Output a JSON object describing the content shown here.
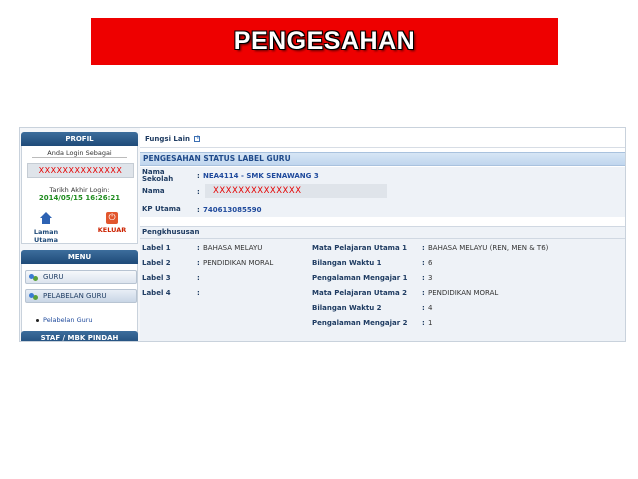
{
  "banner": {
    "title": "PENGESAHAN"
  },
  "sidebar": {
    "profile_header": "PROFIL",
    "login_as": "Anda Login Sebagai",
    "profile_name": "XXXXXXXXXXXXXX",
    "last_login_label": "Tarikh Akhir Login:",
    "last_login_value": "2014/05/15 16:26:21",
    "home_label": "Laman Utama",
    "logout_label": "KELUAR",
    "menu_header": "MENU",
    "menu_items": [
      {
        "label": "GURU"
      },
      {
        "label": "PELABELAN GURU"
      }
    ],
    "sub_item": "Pelabelan Guru",
    "staf_header": "STAF / MBK PINDAH"
  },
  "main": {
    "tab_label": "Fungsi Lain",
    "section_title": "PENGESAHAN STATUS LABEL GURU",
    "school_label_1": "Nama",
    "school_label_2": "Sekolah",
    "school_value": "NEA4114 - SMK SENAWANG 3",
    "name_label": "Nama",
    "name_value": "XXXXXXXXXXXXXX",
    "kp_label": "KP Utama",
    "kp_value": "740613085590",
    "colon": ":",
    "spec_title": "Pengkhususan",
    "labels": [
      {
        "label": "Label 1",
        "value": "BAHASA MELAYU"
      },
      {
        "label": "Label 2",
        "value": "PENDIDIKAN MORAL"
      },
      {
        "label": "Label 3",
        "value": ""
      },
      {
        "label": "Label 4",
        "value": ""
      }
    ],
    "subjects": [
      {
        "label": "Mata Pelajaran Utama 1",
        "value": "BAHASA MELAYU (REN, MEN & T6)"
      },
      {
        "label": "Bilangan Waktu 1",
        "value": "6"
      },
      {
        "label": "Pengalaman Mengajar 1",
        "value": "3"
      },
      {
        "label": "Mata Pelajaran Utama 2",
        "value": "PENDIDIKAN MORAL"
      },
      {
        "label": "Bilangan Waktu 2",
        "value": "4"
      },
      {
        "label": "Pengalaman Mengajar 2",
        "value": "1"
      }
    ]
  },
  "colors": {
    "banner_bg": "#ee0000",
    "accent": "#1f4a78",
    "highlight_red": "#e60000",
    "date_green": "#1f8c1f"
  }
}
